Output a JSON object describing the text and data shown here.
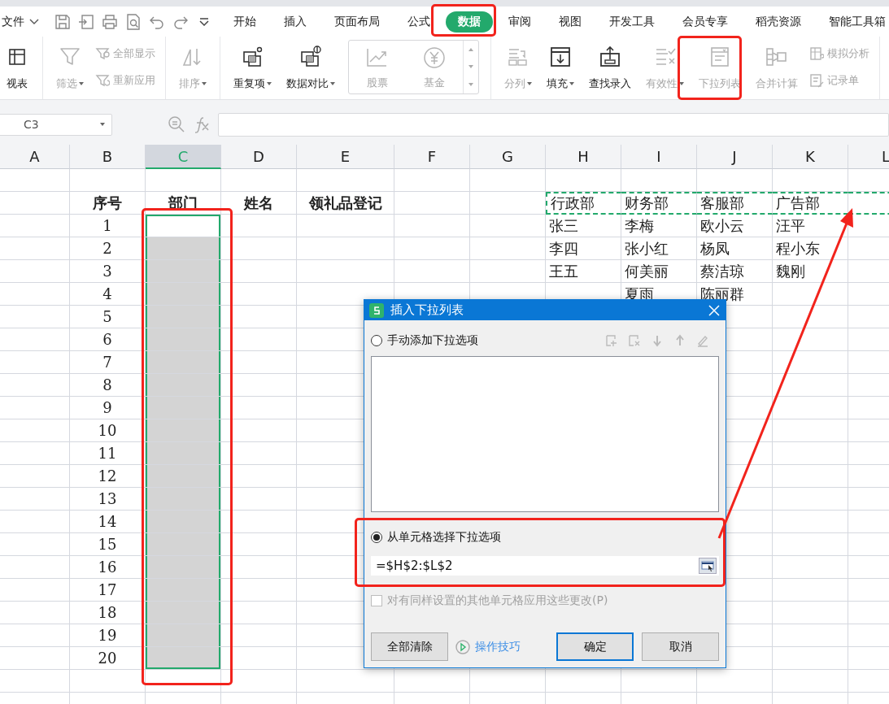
{
  "app_menu": {
    "label": "文件"
  },
  "menu_tabs": [
    {
      "label": "开始",
      "selected": false
    },
    {
      "label": "插入",
      "selected": false
    },
    {
      "label": "页面布局",
      "selected": false
    },
    {
      "label": "公式",
      "selected": false
    },
    {
      "label": "数据",
      "selected": true
    },
    {
      "label": "审阅",
      "selected": false
    },
    {
      "label": "视图",
      "selected": false
    },
    {
      "label": "开发工具",
      "selected": false
    },
    {
      "label": "会员专享",
      "selected": false
    },
    {
      "label": "稻壳资源",
      "selected": false
    },
    {
      "label": "智能工具箱",
      "selected": false
    }
  ],
  "ribbon": {
    "groups": [
      {
        "items": [
          {
            "kind": "large",
            "label": "视表",
            "disabled": false,
            "dropdown": false
          }
        ]
      },
      {
        "items": [
          {
            "kind": "large",
            "label": "筛选",
            "disabled": true,
            "dropdown": true
          },
          {
            "kind": "stack",
            "items": [
              {
                "label": "全部显示",
                "disabled": true
              },
              {
                "label": "重新应用",
                "disabled": true
              }
            ]
          }
        ]
      },
      {
        "items": [
          {
            "kind": "large",
            "label": "排序",
            "disabled": true,
            "dropdown": true
          }
        ]
      },
      {
        "items": [
          {
            "kind": "large",
            "label": "重复项",
            "disabled": false,
            "dropdown": true
          },
          {
            "kind": "large",
            "label": "数据对比",
            "disabled": false,
            "dropdown": true
          },
          {
            "kind": "gallery",
            "items": [
              {
                "label": "股票",
                "disabled": true
              },
              {
                "label": "基金",
                "disabled": true
              }
            ]
          }
        ]
      },
      {
        "items": [
          {
            "kind": "large",
            "label": "分列",
            "disabled": true,
            "dropdown": true
          },
          {
            "kind": "large",
            "label": "填充",
            "disabled": false,
            "dropdown": true
          },
          {
            "kind": "large",
            "label": "查找录入",
            "disabled": false,
            "dropdown": false
          },
          {
            "kind": "large",
            "label": "有效性",
            "disabled": true,
            "dropdown": true
          },
          {
            "kind": "large",
            "label": "下拉列表",
            "disabled": true,
            "dropdown": false
          },
          {
            "kind": "large",
            "label": "合并计算",
            "disabled": true,
            "dropdown": false
          },
          {
            "kind": "stack",
            "items": [
              {
                "label": "模拟分析",
                "disabled": true
              },
              {
                "label": "记录单",
                "disabled": true
              }
            ]
          }
        ]
      }
    ]
  },
  "formula_bar": {
    "name_box": "C3"
  },
  "sheet": {
    "columns": [
      {
        "label": "A",
        "selected": false
      },
      {
        "label": "B",
        "selected": false
      },
      {
        "label": "C",
        "selected": true
      },
      {
        "label": "D",
        "selected": false
      },
      {
        "label": "E",
        "selected": false
      },
      {
        "label": "F",
        "selected": false
      },
      {
        "label": "G",
        "selected": false
      },
      {
        "label": "H",
        "selected": false
      },
      {
        "label": "I",
        "selected": false
      },
      {
        "label": "J",
        "selected": false
      },
      {
        "label": "K",
        "selected": false
      },
      {
        "label": "L",
        "selected": false
      }
    ],
    "rows": [
      {
        "selected": false,
        "active": false,
        "marquee": true,
        "cells": [
          "",
          {
            "text": "序号",
            "bold": true
          },
          {
            "text": "部门",
            "bold": true
          },
          {
            "text": "姓名",
            "bold": true
          },
          {
            "text": "领礼品登记",
            "bold": true
          },
          "",
          "",
          {
            "text": "行政部",
            "bold": false
          },
          {
            "text": "财务部",
            "bold": false
          },
          {
            "text": "客服部",
            "bold": false
          },
          {
            "text": "广告部",
            "bold": false
          }
        ]
      },
      {
        "selected": false,
        "active": true,
        "marquee": false,
        "cells": [
          "",
          {
            "text": "1",
            "bold": false
          },
          "",
          "",
          "",
          "",
          "",
          {
            "text": "张三",
            "bold": false
          },
          {
            "text": "李梅",
            "bold": false
          },
          {
            "text": "欧小云",
            "bold": false
          },
          {
            "text": "汪平",
            "bold": false
          }
        ]
      },
      {
        "selected": true,
        "active": false,
        "marquee": false,
        "cells": [
          "",
          {
            "text": "2",
            "bold": false
          },
          "",
          "",
          "",
          "",
          "",
          {
            "text": "李四",
            "bold": false
          },
          {
            "text": "张小红",
            "bold": false
          },
          {
            "text": "杨凤",
            "bold": false
          },
          {
            "text": "程小东",
            "bold": false
          }
        ]
      },
      {
        "selected": true,
        "active": false,
        "marquee": false,
        "cells": [
          "",
          {
            "text": "3",
            "bold": false
          },
          "",
          "",
          "",
          "",
          "",
          {
            "text": "王五",
            "bold": false
          },
          {
            "text": "何美丽",
            "bold": false
          },
          {
            "text": "蔡洁琼",
            "bold": false
          },
          {
            "text": "魏刚",
            "bold": false
          }
        ]
      },
      {
        "selected": true,
        "active": false,
        "marquee": false,
        "cells": [
          "",
          {
            "text": "4",
            "bold": false
          },
          "",
          "",
          "",
          "",
          "",
          "",
          {
            "text": "夏雨",
            "bold": false
          },
          {
            "text": "陈丽群",
            "bold": false
          }
        ]
      },
      {
        "selected": true,
        "active": false,
        "marquee": false,
        "cells": [
          "",
          {
            "text": "5",
            "bold": false
          }
        ]
      },
      {
        "selected": true,
        "active": false,
        "marquee": false,
        "cells": [
          "",
          {
            "text": "6",
            "bold": false
          }
        ]
      },
      {
        "selected": true,
        "active": false,
        "marquee": false,
        "cells": [
          "",
          {
            "text": "7",
            "bold": false
          }
        ]
      },
      {
        "selected": true,
        "active": false,
        "marquee": false,
        "cells": [
          "",
          {
            "text": "8",
            "bold": false
          }
        ]
      },
      {
        "selected": true,
        "active": false,
        "marquee": false,
        "cells": [
          "",
          {
            "text": "9",
            "bold": false
          }
        ]
      },
      {
        "selected": true,
        "active": false,
        "marquee": false,
        "cells": [
          "",
          {
            "text": "10",
            "bold": false
          }
        ]
      },
      {
        "selected": true,
        "active": false,
        "marquee": false,
        "cells": [
          "",
          {
            "text": "11",
            "bold": false
          }
        ]
      },
      {
        "selected": true,
        "active": false,
        "marquee": false,
        "cells": [
          "",
          {
            "text": "12",
            "bold": false
          }
        ]
      },
      {
        "selected": true,
        "active": false,
        "marquee": false,
        "cells": [
          "",
          {
            "text": "13",
            "bold": false
          }
        ]
      },
      {
        "selected": true,
        "active": false,
        "marquee": false,
        "cells": [
          "",
          {
            "text": "14",
            "bold": false
          }
        ]
      },
      {
        "selected": true,
        "active": false,
        "marquee": false,
        "cells": [
          "",
          {
            "text": "15",
            "bold": false
          }
        ]
      },
      {
        "selected": true,
        "active": false,
        "marquee": false,
        "cells": [
          "",
          {
            "text": "16",
            "bold": false
          }
        ]
      },
      {
        "selected": true,
        "active": false,
        "marquee": false,
        "cells": [
          "",
          {
            "text": "17",
            "bold": false
          }
        ]
      },
      {
        "selected": true,
        "active": false,
        "marquee": false,
        "cells": [
          "",
          {
            "text": "18",
            "bold": false
          }
        ]
      },
      {
        "selected": true,
        "active": false,
        "marquee": false,
        "cells": [
          "",
          {
            "text": "19",
            "bold": false
          }
        ]
      },
      {
        "selected": true,
        "active": false,
        "marquee": false,
        "cells": [
          "",
          {
            "text": "20",
            "bold": false
          }
        ]
      }
    ]
  },
  "dialog": {
    "title": "插入下拉列表",
    "options": [
      {
        "label": "手动添加下拉选项",
        "selected": false
      },
      {
        "label": "从单元格选择下拉选项",
        "selected": true
      }
    ],
    "source": {
      "value": "=$H$2:$L$2"
    },
    "apply_all": {
      "label": "对有同样设置的其他单元格应用这些更改(P)",
      "checked": false,
      "disabled": true
    },
    "clear_button": "全部清除",
    "tips_link": "操作技巧",
    "ok_button": "确定",
    "cancel_button": "取消"
  }
}
